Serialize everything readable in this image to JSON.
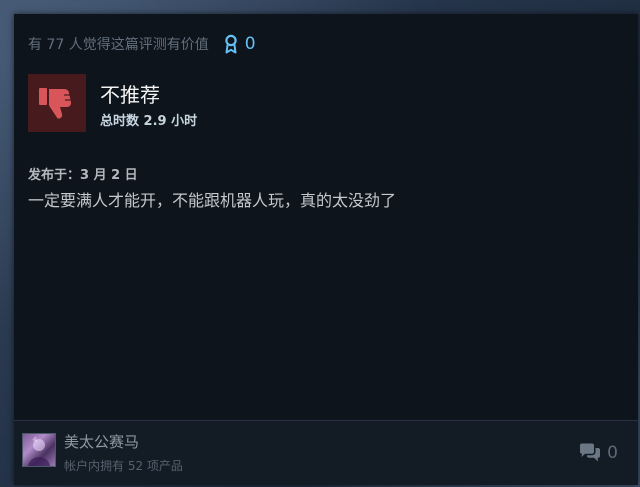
{
  "review": {
    "helpful_text": "有 77 人觉得这篇评测有价值",
    "award_count": "0",
    "verdict": "不推荐",
    "hours": "总时数 2.9 小时",
    "posted": "发布于：3 月 2 日",
    "body": "一定要满人才能开，不能跟机器人玩，真的太没劲了"
  },
  "author": {
    "name": "美太公赛马",
    "owned": "帐户内拥有 52 项产品",
    "comment_count": "0"
  },
  "colors": {
    "thumb_bg": "#471b1d",
    "thumb_icon": "#d8565a",
    "award": "#66c0f4"
  },
  "icons": {
    "award": "award-ribbon-icon",
    "thumb": "thumbs-down-icon",
    "comment": "comment-bubbles-icon"
  }
}
